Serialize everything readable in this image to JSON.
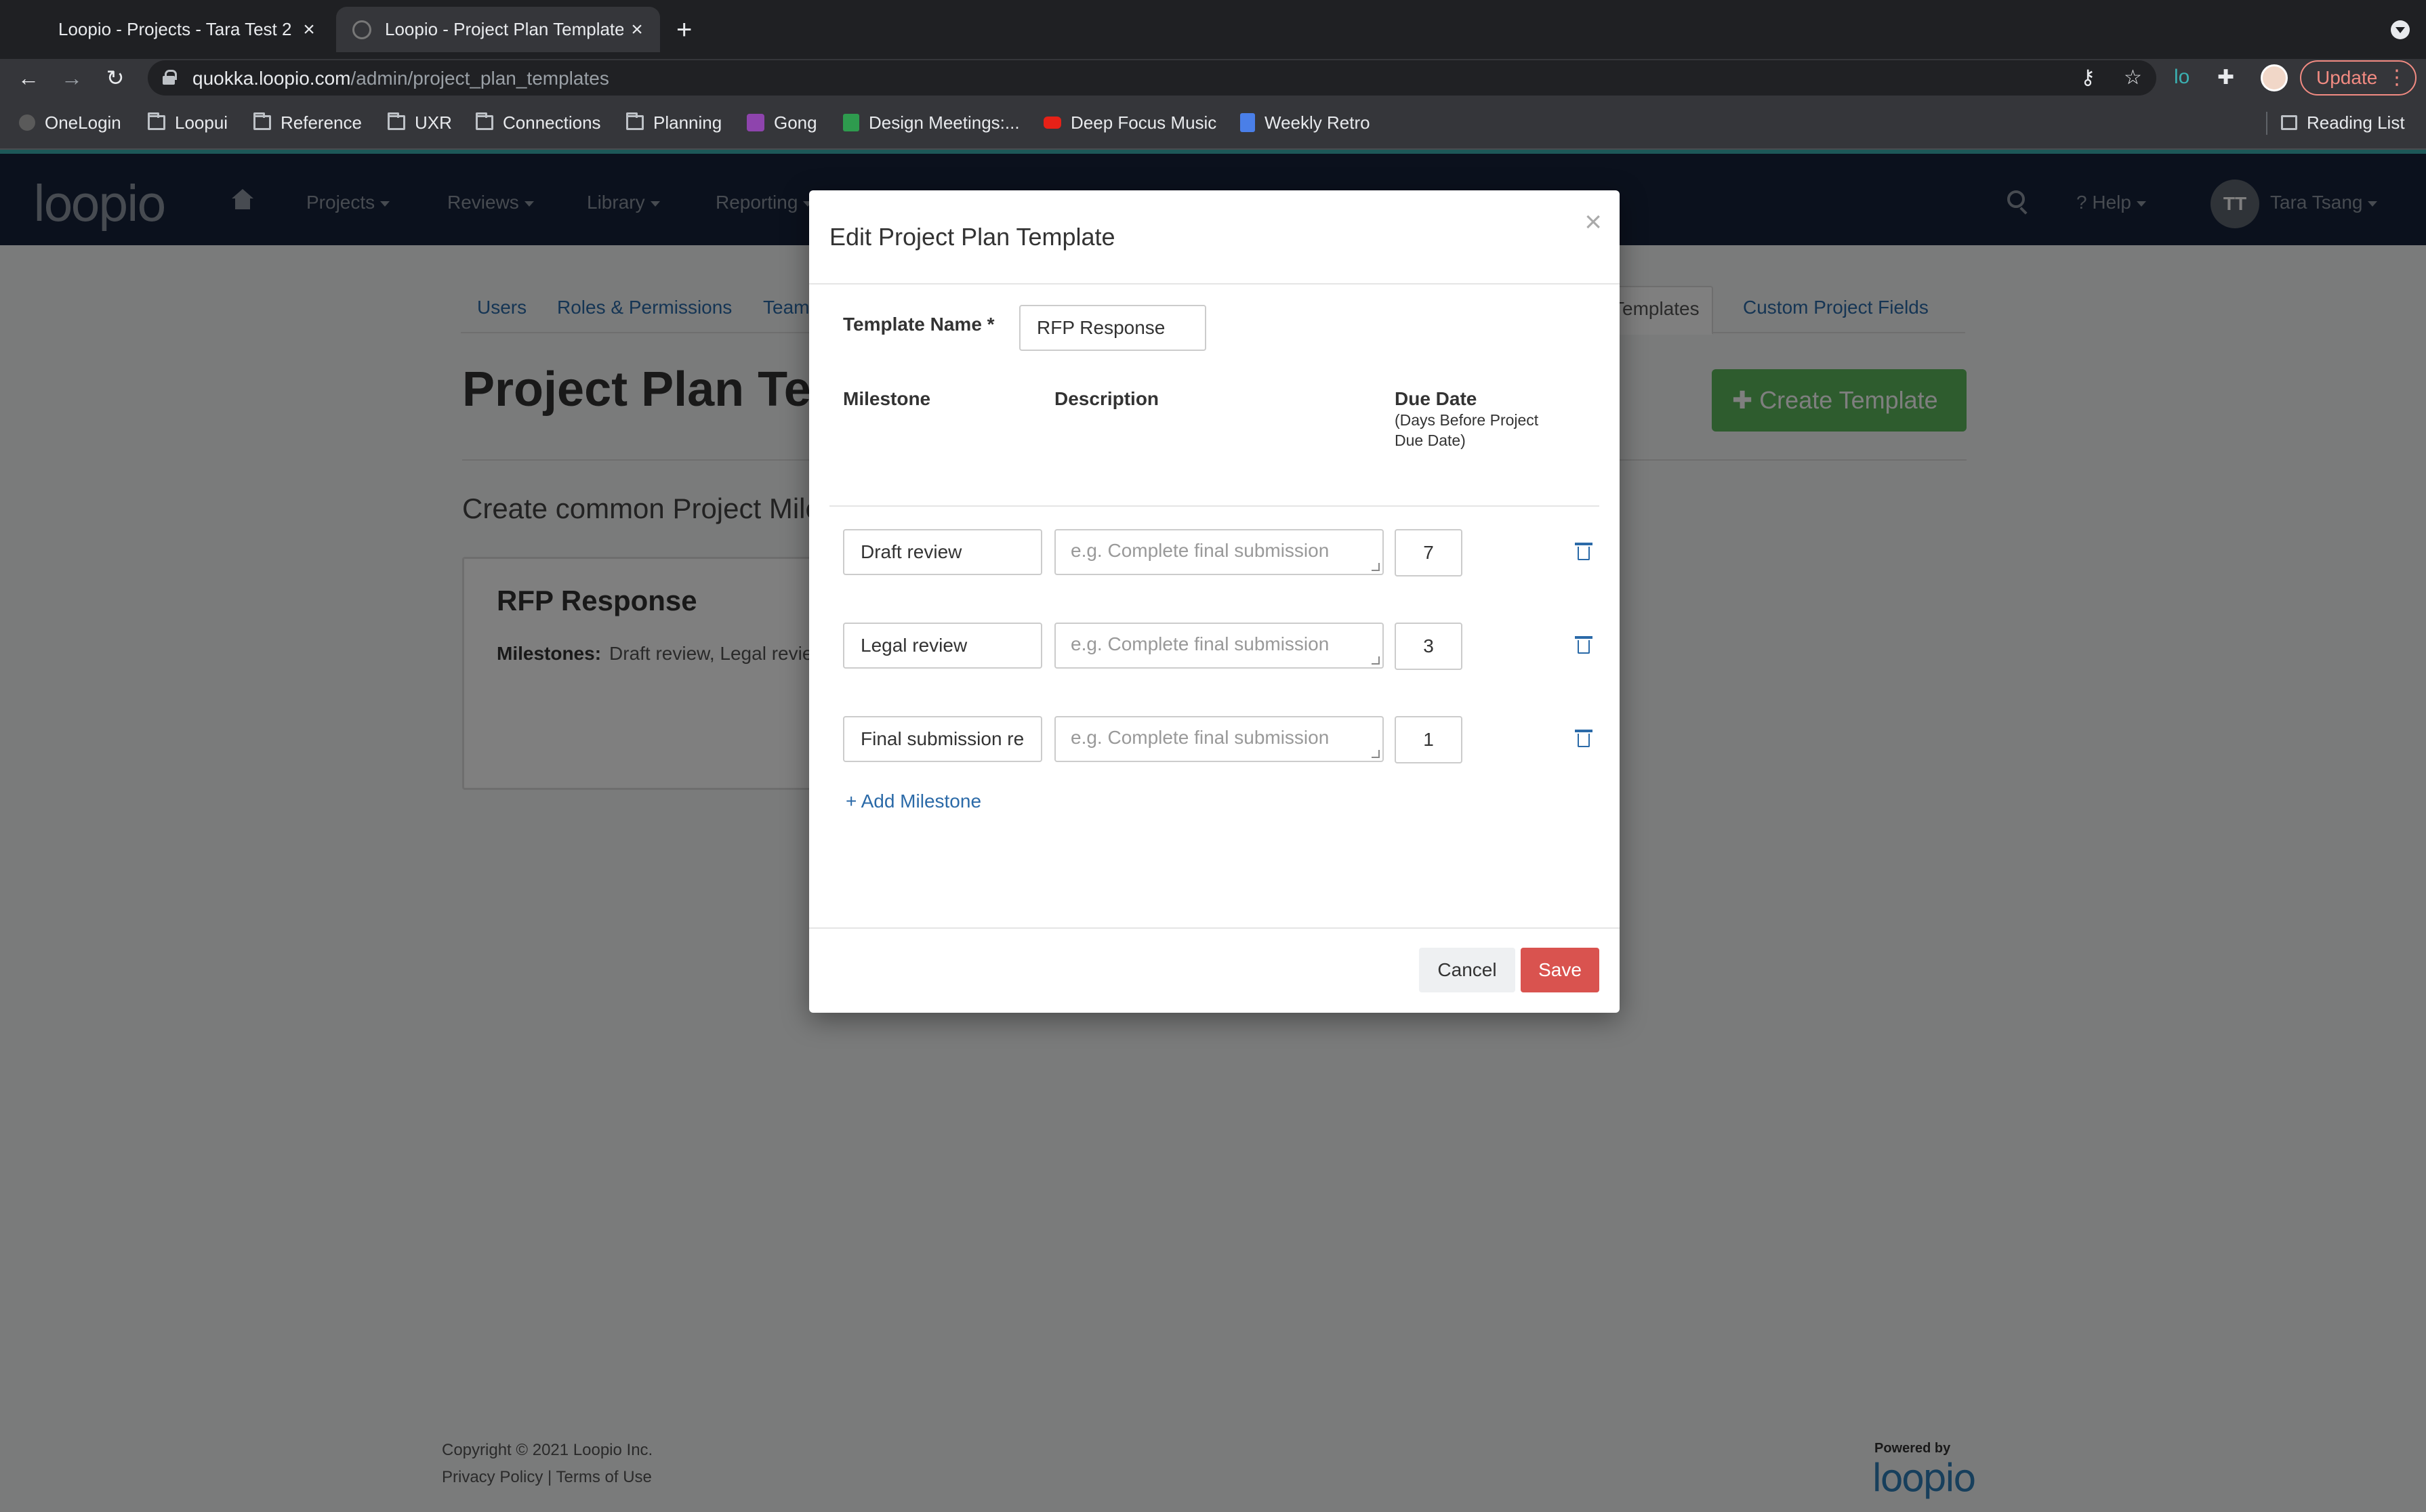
{
  "browser": {
    "tabs": [
      {
        "title": "Loopio - Projects - Tara Test 2",
        "active": false
      },
      {
        "title": "Loopio - Project Plan Template",
        "active": true
      }
    ],
    "url_host": "quokka.loopio.com",
    "url_path": "/admin/project_plan_templates",
    "update_label": "Update",
    "bookmarks": [
      {
        "label": "OneLogin",
        "icon": "circle-icon"
      },
      {
        "label": "Loopui",
        "icon": "folder-icon"
      },
      {
        "label": "Reference",
        "icon": "folder-icon"
      },
      {
        "label": "UXR",
        "icon": "folder-icon"
      },
      {
        "label": "Connections",
        "icon": "folder-icon"
      },
      {
        "label": "Planning",
        "icon": "folder-icon"
      },
      {
        "label": "Gong",
        "icon": "gong-icon"
      },
      {
        "label": "Design Meetings:...",
        "icon": "sheets-icon"
      },
      {
        "label": "Deep Focus Music",
        "icon": "youtube-icon"
      },
      {
        "label": "Weekly Retro",
        "icon": "docs-icon"
      }
    ],
    "reading_list": "Reading List"
  },
  "app": {
    "logo": "loopio",
    "nav": {
      "projects": "Projects",
      "reviews": "Reviews",
      "library": "Library",
      "reporting": "Reporting",
      "help": "Help",
      "user_initials": "TT",
      "user_name": "Tara Tsang"
    },
    "subnav": {
      "users": "Users",
      "roles": "Roles & Permissions",
      "teams": "Teams",
      "templates": "Templates",
      "custom_fields": "Custom Project Fields"
    },
    "page_title": "Project Plan Templates",
    "create_button": "Create Template",
    "lead_text": "Create common Project Milestones",
    "card": {
      "title": "RFP Response",
      "milestones_label": "Milestones:",
      "milestones_value": "Draft review,  Legal review"
    },
    "footer": {
      "copyright": "Copyright © 2021 Loopio Inc.",
      "privacy": "Privacy Policy",
      "sep": "|",
      "terms": "Terms of Use",
      "powered_by": "Powered by",
      "powered_logo": "loopio"
    }
  },
  "modal": {
    "title": "Edit Project Plan Template",
    "close": "×",
    "template_name_label": "Template Name *",
    "template_name_value": "RFP Response",
    "col_milestone": "Milestone",
    "col_description": "Description",
    "col_due": "Due Date",
    "col_due_sub": "(Days Before Project Due Date)",
    "description_placeholder": "e.g. Complete final submission",
    "milestones": [
      {
        "name": "Draft review",
        "days": "7"
      },
      {
        "name": "Legal review",
        "days": "3"
      },
      {
        "name": "Final submission re",
        "days": "1"
      }
    ],
    "add_milestone": "+ Add Milestone",
    "cancel": "Cancel",
    "save": "Save"
  }
}
